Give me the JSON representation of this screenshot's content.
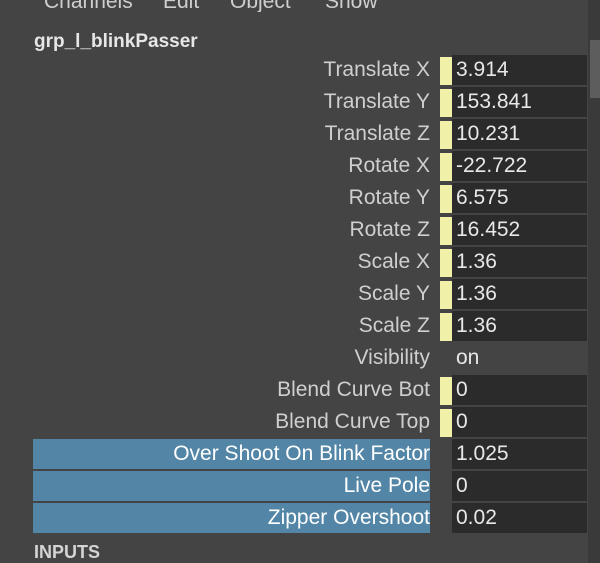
{
  "menu": [
    "Channels",
    "Edit",
    "Object",
    "Show"
  ],
  "node_name": "grp_l_blinkPasser",
  "channels": [
    {
      "label": "Translate X",
      "value": "3.914",
      "keyed": true,
      "selected": false
    },
    {
      "label": "Translate Y",
      "value": "153.841",
      "keyed": true,
      "selected": false
    },
    {
      "label": "Translate Z",
      "value": "10.231",
      "keyed": true,
      "selected": false
    },
    {
      "label": "Rotate X",
      "value": "-22.722",
      "keyed": true,
      "selected": false
    },
    {
      "label": "Rotate Y",
      "value": "6.575",
      "keyed": true,
      "selected": false
    },
    {
      "label": "Rotate Z",
      "value": "16.452",
      "keyed": true,
      "selected": false
    },
    {
      "label": "Scale X",
      "value": "1.36",
      "keyed": true,
      "selected": false
    },
    {
      "label": "Scale Y",
      "value": "1.36",
      "keyed": true,
      "selected": false
    },
    {
      "label": "Scale Z",
      "value": "1.36",
      "keyed": true,
      "selected": false
    },
    {
      "label": "Visibility",
      "value": "on",
      "keyed": false,
      "selected": false
    },
    {
      "label": "Blend Curve Bot",
      "value": "0",
      "keyed": true,
      "selected": false
    },
    {
      "label": "Blend Curve Top",
      "value": "0",
      "keyed": true,
      "selected": false
    },
    {
      "label": "Over Shoot On Blink Factor",
      "value": "1.025",
      "keyed": false,
      "selected": true
    },
    {
      "label": "Live Pole",
      "value": "0",
      "keyed": false,
      "selected": true
    },
    {
      "label": "Zipper Overshoot",
      "value": "0.02",
      "keyed": false,
      "selected": true
    }
  ],
  "section": "INPUTS",
  "colors": {
    "panel_bg": "#444444",
    "field_bg": "#2b2b2b",
    "keyed_swatch": "#f0f0a8",
    "selected_label_bg": "#5285a6"
  }
}
